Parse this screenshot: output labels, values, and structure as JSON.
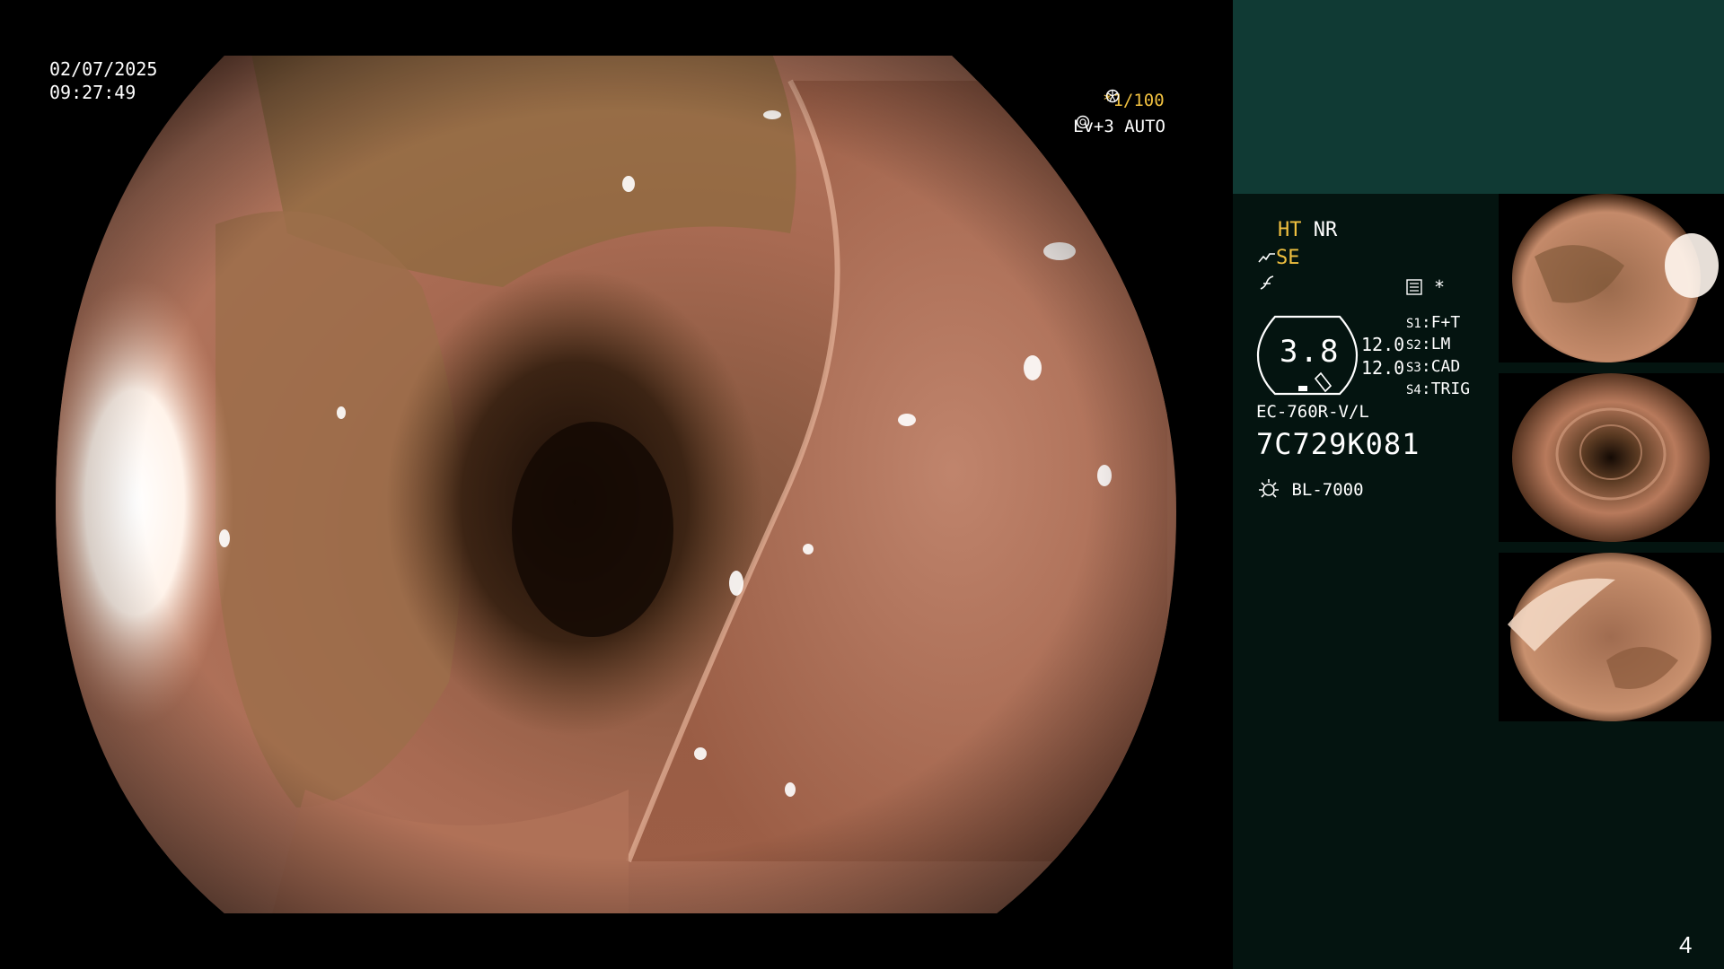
{
  "overlay": {
    "date": "02/07/2025",
    "time": "09:27:49",
    "shutter": "*1/100",
    "level": "Lv+3",
    "iris_mode": "AUTO"
  },
  "panel": {
    "ht": "HT",
    "nr": "NR",
    "se": "SE",
    "star": "*",
    "gauge_value": "3.8",
    "magnification_1": "12.0",
    "magnification_2": "12.0",
    "switches": [
      {
        "key": "S1",
        "value": "F+T"
      },
      {
        "key": "S2",
        "value": "LM"
      },
      {
        "key": "S3",
        "value": "CAD"
      },
      {
        "key": "S4",
        "value": "TRIG"
      }
    ],
    "scope_model": "EC-760R-V/L",
    "scope_serial": "7C729K081",
    "light_source": "BL-7000"
  },
  "thumbnails": [
    {
      "name": "captured-image-1"
    },
    {
      "name": "captured-image-2"
    },
    {
      "name": "captured-image-3"
    }
  ],
  "page_number": "4",
  "colors": {
    "panel_top": "#103a34",
    "panel_body": "#041410",
    "highlight": "#f0c040"
  }
}
